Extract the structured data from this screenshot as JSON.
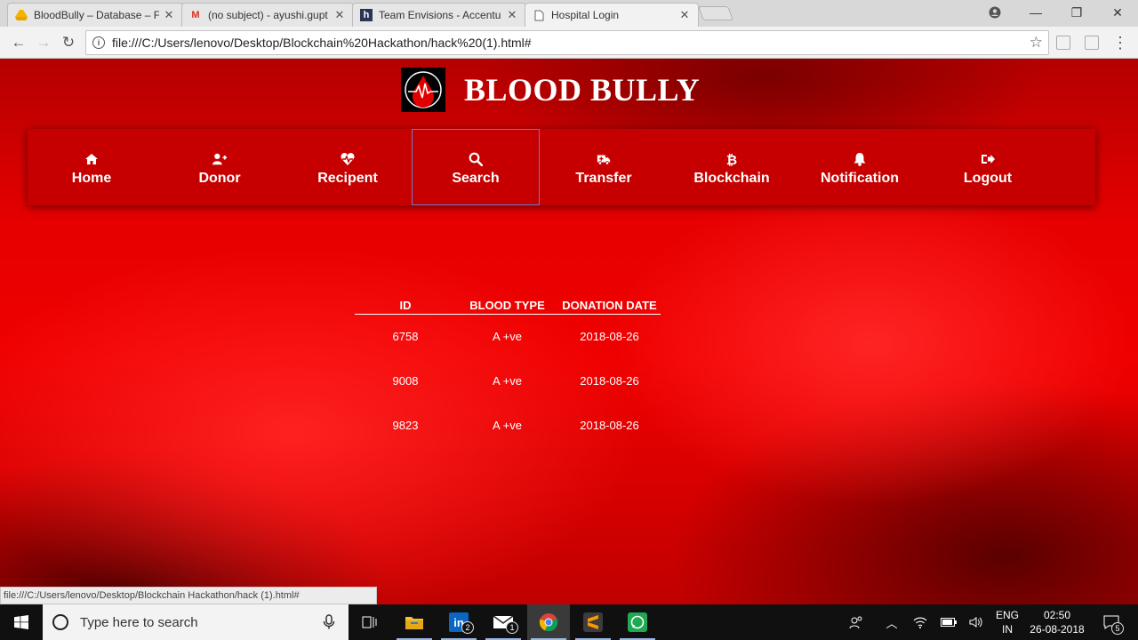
{
  "browser": {
    "tabs": [
      {
        "title": "BloodBully – Database – F",
        "favicon": "drive-icon"
      },
      {
        "title": "(no subject) - ayushi.gupt",
        "favicon": "gmail-icon"
      },
      {
        "title": "Team Envisions - Accentu",
        "favicon": "hackerearth-icon"
      },
      {
        "title": "Hospital Login",
        "favicon": "document-icon"
      }
    ],
    "url": "file:///C:/Users/lenovo/Desktop/Blockchain%20Hackathon/hack%20(1).html#",
    "status_url": "file:///C:/Users/lenovo/Desktop/Blockchain Hackathon/hack (1).html#"
  },
  "page": {
    "brand_title": "BLOOD BULLY",
    "nav": [
      {
        "label": "Home",
        "icon": "home-icon"
      },
      {
        "label": "Donor",
        "icon": "user-plus-icon"
      },
      {
        "label": "Recipent",
        "icon": "heartbeat-icon"
      },
      {
        "label": "Search",
        "icon": "search-icon",
        "active": true
      },
      {
        "label": "Transfer",
        "icon": "ambulance-icon"
      },
      {
        "label": "Blockchain",
        "icon": "bitcoin-icon"
      },
      {
        "label": "Notification",
        "icon": "bell-icon"
      },
      {
        "label": "Logout",
        "icon": "sign-out-icon"
      }
    ],
    "table": {
      "headers": [
        "ID",
        "BLOOD TYPE",
        "DONATION DATE"
      ],
      "rows": [
        [
          "6758",
          "A +ve",
          "2018-08-26"
        ],
        [
          "9008",
          "A +ve",
          "2018-08-26"
        ],
        [
          "9823",
          "A +ve",
          "2018-08-26"
        ]
      ]
    }
  },
  "taskbar": {
    "search_placeholder": "Type here to search",
    "linkedin_badge": "2",
    "mail_badge": "1",
    "language": "ENG",
    "region": "IN",
    "time": "02:50",
    "date": "26-08-2018",
    "notifications": "5"
  },
  "colors": {
    "accent": "#c60000",
    "brand_text": "#ffffff"
  }
}
